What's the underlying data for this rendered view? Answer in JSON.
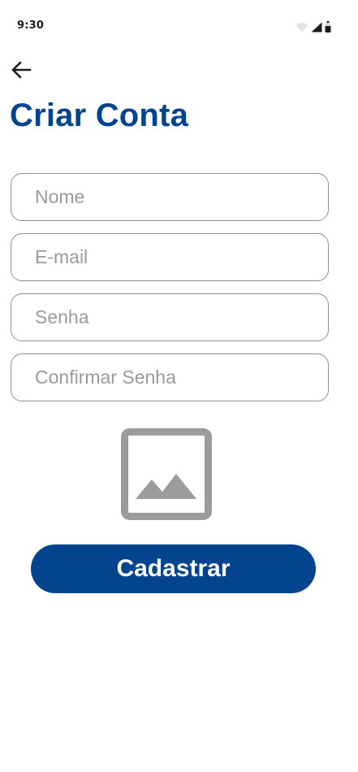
{
  "status_bar": {
    "time": "9:30",
    "icons": [
      "wifi-icon",
      "signal-icon",
      "battery-icon"
    ]
  },
  "header": {
    "back_icon": "arrow-left-icon",
    "title": "Criar Conta"
  },
  "form": {
    "name_placeholder": "Nome",
    "email_placeholder": "E-mail",
    "password_placeholder": "Senha",
    "confirm_password_placeholder": "Confirmar Senha",
    "image_icon": "image-placeholder-icon",
    "submit_label": "Cadastrar"
  },
  "colors": {
    "primary": "#03448f",
    "field_border": "#8f8f8f",
    "placeholder": "#9a9a9a",
    "image_icon": "#9e9b9b"
  }
}
